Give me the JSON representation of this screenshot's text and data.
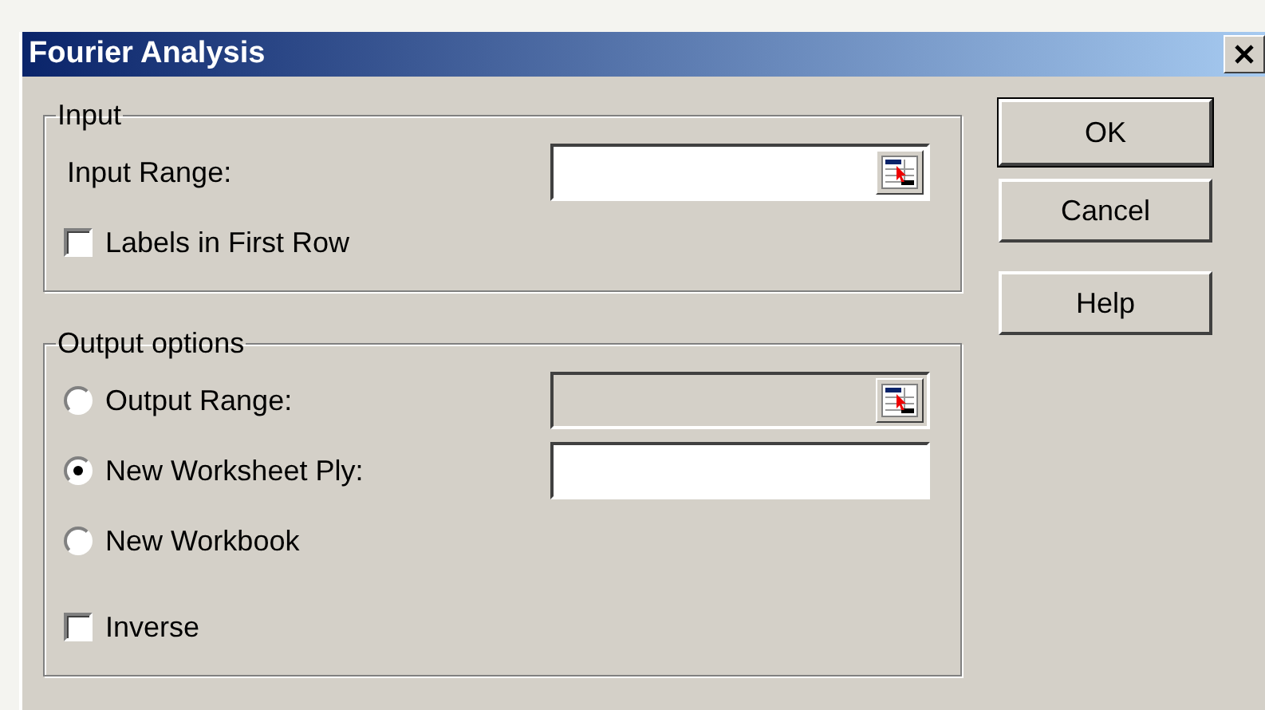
{
  "window": {
    "title": "Fourier Analysis"
  },
  "groups": [
    {
      "title": "Input",
      "rows": [
        {
          "kind": "field",
          "label": "Input Range:",
          "field": {
            "disabled": false,
            "picker": true
          }
        },
        {
          "kind": "checkbox",
          "label": "Labels in First Row",
          "checked": false
        }
      ]
    },
    {
      "title": "Output options",
      "rows": [
        {
          "kind": "radio",
          "label": "Output Range:",
          "selected": false,
          "field": {
            "disabled": true,
            "picker": true
          }
        },
        {
          "kind": "radio",
          "label": "New Worksheet Ply:",
          "selected": true,
          "field": {
            "disabled": false,
            "picker": false
          }
        },
        {
          "kind": "radio",
          "label": "New Workbook",
          "selected": false
        },
        {
          "kind": "checkbox",
          "label": "Inverse",
          "checked": false
        }
      ]
    }
  ],
  "buttons": [
    {
      "label": "OK",
      "default": true
    },
    {
      "label": "Cancel",
      "default": false
    },
    {
      "label": "Help",
      "default": false
    }
  ]
}
